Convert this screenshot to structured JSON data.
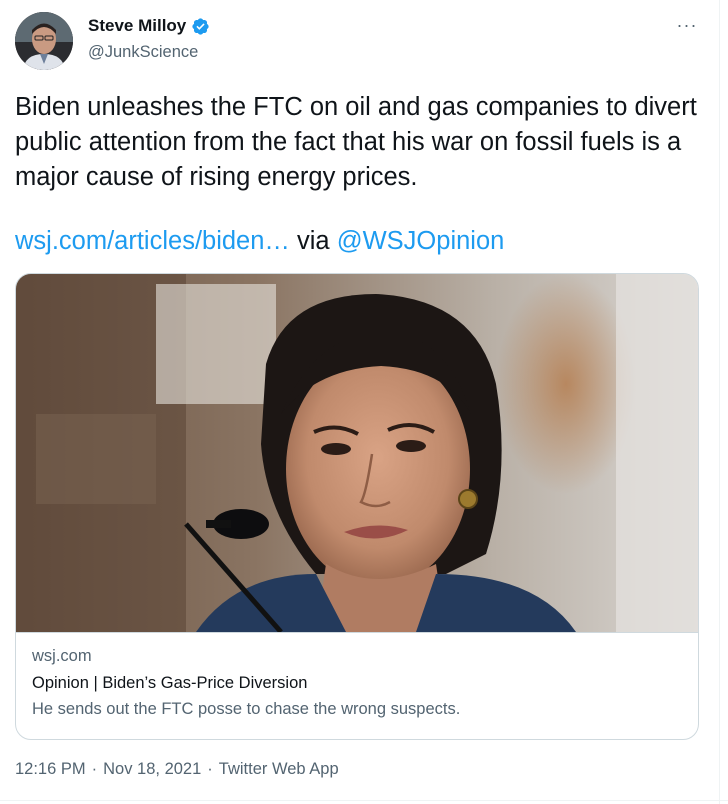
{
  "author": {
    "display_name": "Steve Milloy",
    "handle": "@JunkScience",
    "verified_icon": "verified-badge-icon",
    "verified_color": "#1d9bf0"
  },
  "menu": {
    "more_label": "···"
  },
  "tweet": {
    "text": "Biden unleashes the FTC on oil and gas companies to divert public attention from the fact that his war on fossil fuels is a major cause of rising energy prices.",
    "link_text": "wsj.com/articles/biden…",
    "via_text": "via",
    "via_handle": "@WSJOpinion",
    "link_color": "#1d9bf0"
  },
  "card": {
    "domain": "wsj.com",
    "title": "Opinion | Biden’s Gas-Price Diversion",
    "description": "He sends out the FTC posse to chase the wrong suspects."
  },
  "meta": {
    "time": "12:16 PM",
    "separator": "·",
    "date": "Nov 18, 2021",
    "source": "Twitter Web App"
  }
}
